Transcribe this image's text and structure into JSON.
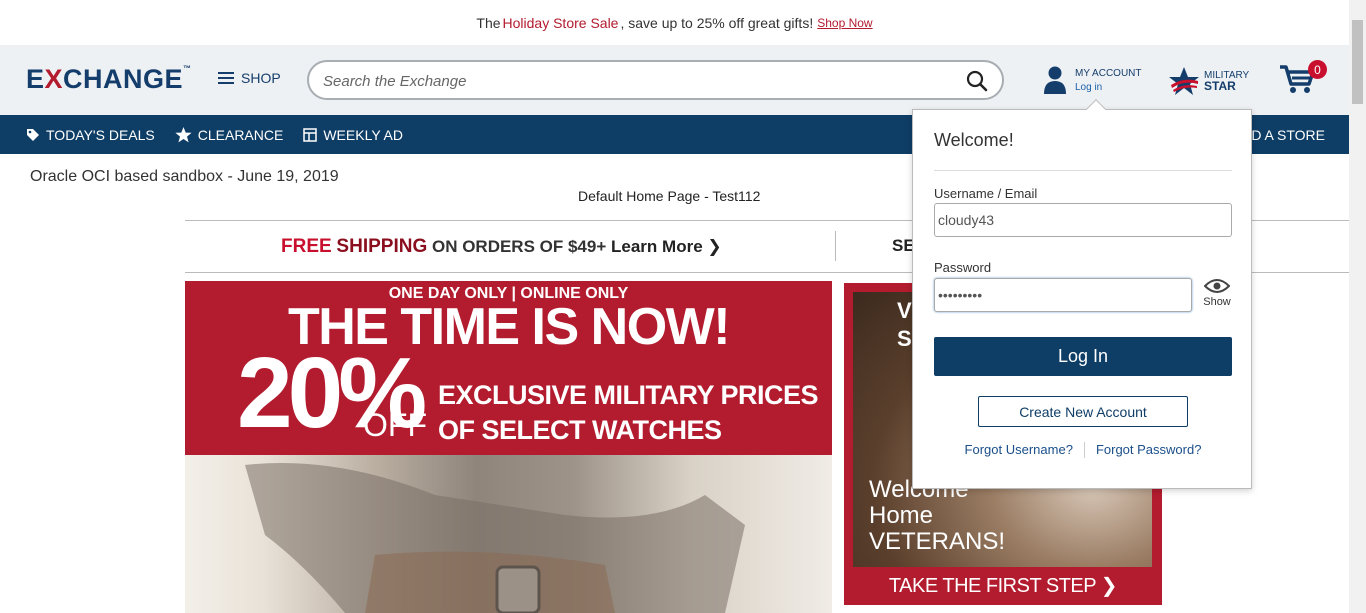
{
  "promo": {
    "prefix": "The",
    "highlight": "Holiday Store Sale",
    "suffix": ", save up to 25% off great gifts!",
    "link": "Shop Now"
  },
  "header": {
    "logo_pre": "E",
    "logo_x": "X",
    "logo_post": "CHANGE",
    "logo_tm": "™",
    "shop_label": "SHOP",
    "search_placeholder": "Search the Exchange",
    "account_label": "MY ACCOUNT",
    "account_sub": "Log in",
    "military_label": "MILITARY",
    "star_label": "STAR",
    "cart_count": "0"
  },
  "nav": {
    "deals": "TODAY'S DEALS",
    "clearance": "CLEARANCE",
    "weekly": "WEEKLY AD",
    "find_store": "ND A STORE"
  },
  "main": {
    "sandbox": "Oracle OCI based sandbox - June 19, 2019",
    "default_home": "Default Home Page - Test112",
    "shipping": {
      "free": "FREE",
      "ship": "SHIPPING",
      "rest": "ON ORDERS OF $49+",
      "learn_more": "Learn More ❯",
      "second": "SE"
    },
    "hero": {
      "line1": "ONE DAY ONLY | ONLINE ONLY",
      "line2": "THE TIME IS NOW!",
      "percent": "20%",
      "off": "OFF",
      "exclusive1": "EXCLUSIVE MILITARY PRICES",
      "exclusive2": "OF SELECT WATCHES"
    },
    "veterans": {
      "top1": "V",
      "top2": "SI",
      "welcome1": "Welcome",
      "welcome2": "Home",
      "welcome3": "VETERANS!",
      "cta": "TAKE THE FIRST STEP ❯"
    }
  },
  "login_popup": {
    "title": "Welcome!",
    "username_label": "Username / Email",
    "username_value": "cloudy43",
    "password_label": "Password",
    "password_value": "•••••••••",
    "show_label": "Show",
    "login_button": "Log In",
    "create_button": "Create New Account",
    "forgot_username": "Forgot Username?",
    "forgot_password": "Forgot Password?"
  },
  "colors": {
    "navy": "#0e3d66",
    "red": "#b31b2e",
    "badge": "#c8102e"
  }
}
